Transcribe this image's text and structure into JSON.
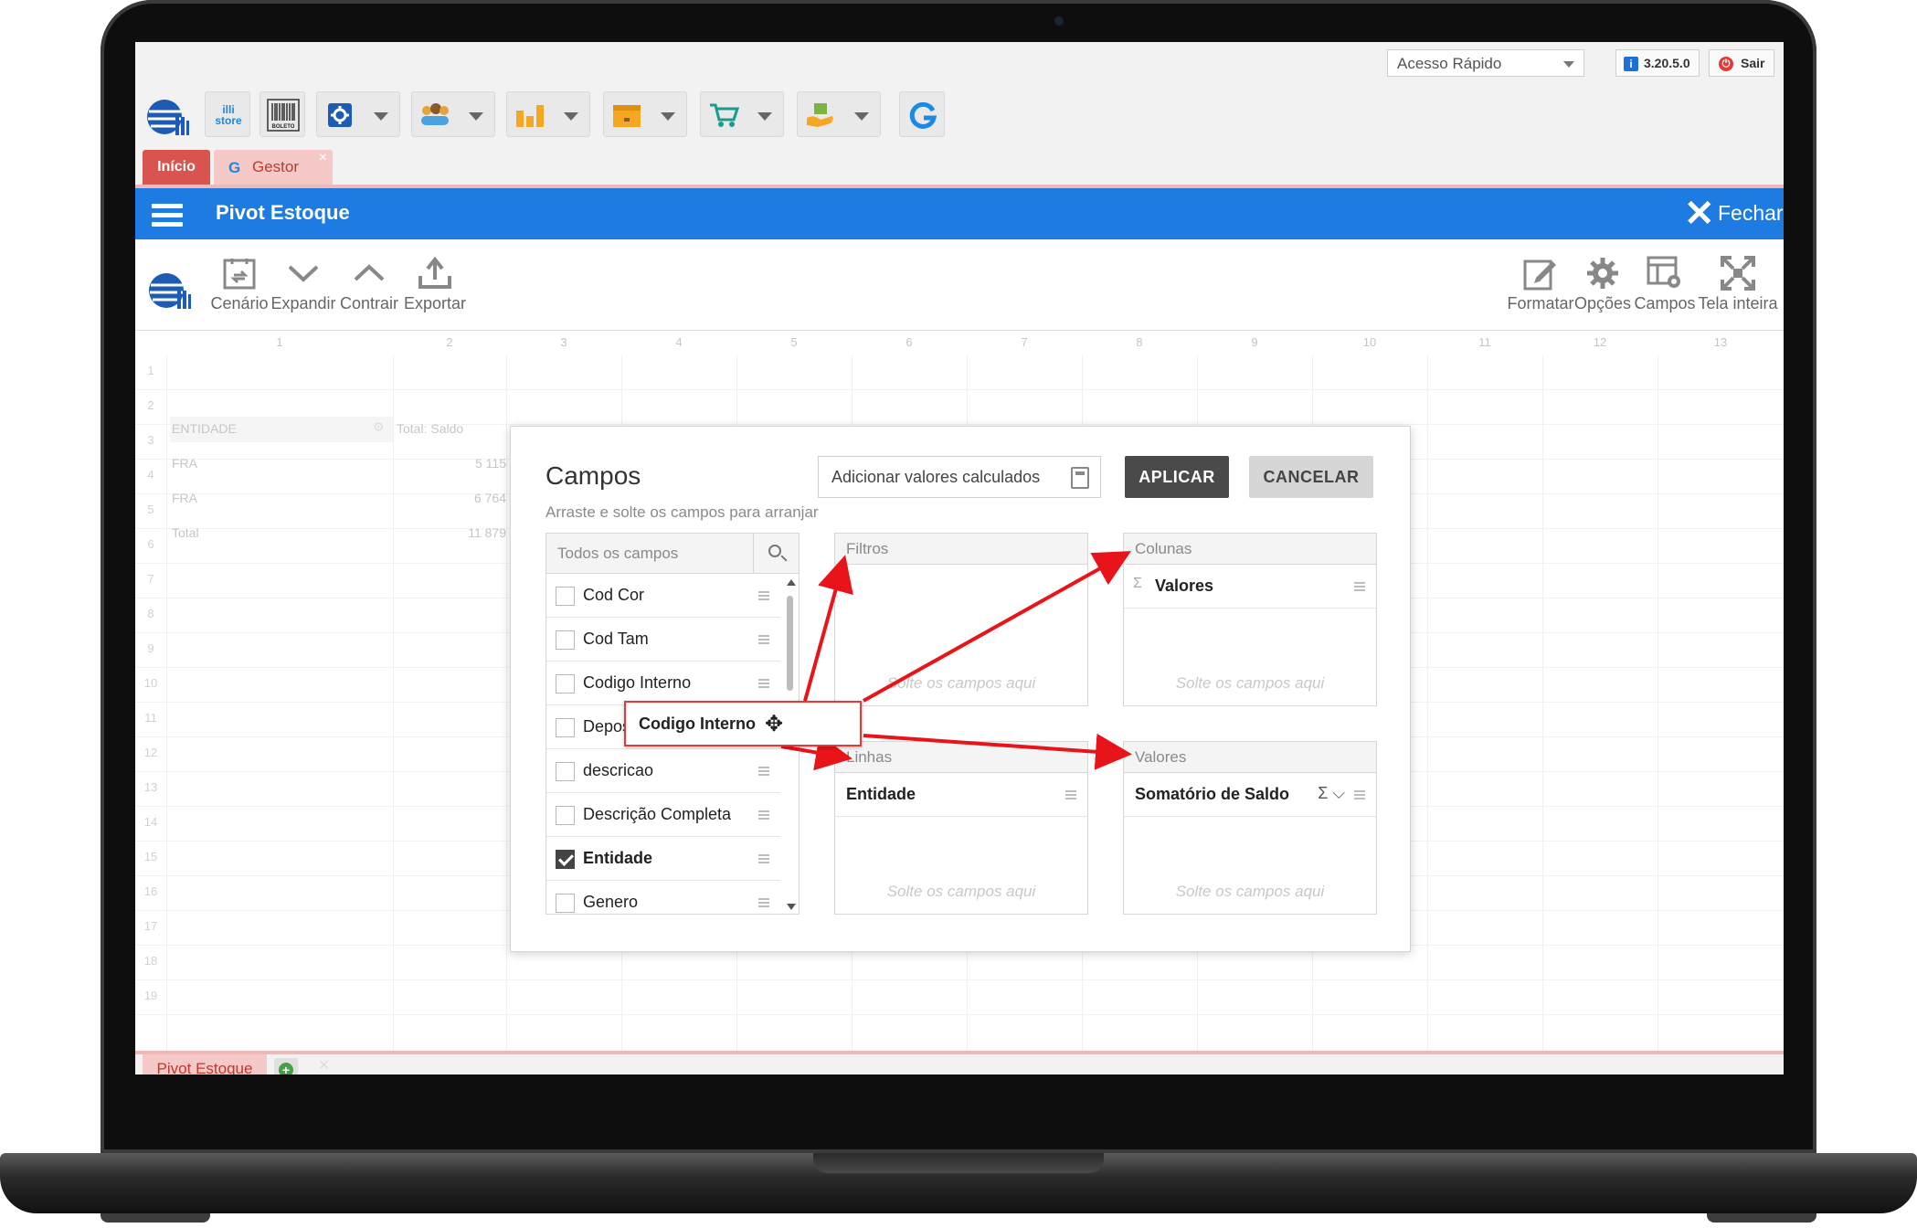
{
  "topbar": {
    "quick_access": "Acesso Rápido",
    "version": "3.20.5.0",
    "logout": "Sair",
    "tools": [
      {
        "name": "store-icon",
        "label": "illi store"
      },
      {
        "name": "barcode-icon",
        "label": "BOLETO"
      },
      {
        "name": "gear-icon",
        "label": ""
      },
      {
        "name": "users-icon",
        "label": ""
      },
      {
        "name": "bar-chart-icon",
        "label": ""
      },
      {
        "name": "box-icon",
        "label": ""
      },
      {
        "name": "cart-icon",
        "label": ""
      },
      {
        "name": "package-hand-icon",
        "label": ""
      },
      {
        "name": "refresh-icon",
        "label": ""
      }
    ]
  },
  "tabs": {
    "inicio": "Início",
    "gestor": "Gestor",
    "bottom": "Pivot Estoque"
  },
  "titlebar": {
    "title": "Pivot Estoque",
    "close": "Fechar"
  },
  "toolbar": {
    "left": [
      "Cenário",
      "Expandir",
      "Contrair",
      "Exportar"
    ],
    "right": [
      "Formatar",
      "Opções",
      "Campos",
      "Tela inteira"
    ]
  },
  "grid": {
    "column_headers": [
      "1",
      "2",
      "3",
      "4",
      "5",
      "6",
      "7",
      "8",
      "9",
      "10",
      "11",
      "12",
      "13"
    ],
    "row_numbers": [
      "1",
      "2",
      "3",
      "4",
      "5",
      "6",
      "7",
      "8",
      "9",
      "10",
      "11",
      "12",
      "13",
      "14",
      "15",
      "16",
      "17",
      "18",
      "19"
    ],
    "header": {
      "entity": "ENTIDADE",
      "total": "Total: Saldo"
    },
    "rows": [
      {
        "label": "FRA",
        "value": "5 115"
      },
      {
        "label": "FRA",
        "value": "6 764"
      },
      {
        "label": "Total",
        "value": "11 879"
      }
    ]
  },
  "dialog": {
    "title": "Campos",
    "subtitle": "Arraste e solte os campos para arranjar",
    "calc_button": "Adicionar valores calculados",
    "apply": "APLICAR",
    "cancel": "CANCELAR",
    "all_fields_label": "Todos os campos",
    "fields": [
      {
        "label": "Cod Cor",
        "checked": false
      },
      {
        "label": "Cod Tam",
        "checked": false
      },
      {
        "label": "Codigo Interno",
        "checked": false
      },
      {
        "label": "Depos",
        "checked": false
      },
      {
        "label": "descricao",
        "checked": false
      },
      {
        "label": "Descrição Completa",
        "checked": false
      },
      {
        "label": "Entidade",
        "checked": true
      },
      {
        "label": "Genero",
        "checked": false
      }
    ],
    "drag_ghost": "Codigo Interno",
    "zones": {
      "filtros": {
        "title": "Filtros",
        "placeholder": "Solte os campos aqui"
      },
      "colunas": {
        "title": "Colunas",
        "item": "Valores",
        "placeholder": "Solte os campos aqui"
      },
      "linhas": {
        "title": "Linhas",
        "item": "Entidade",
        "placeholder": "Solte os campos aqui"
      },
      "valores": {
        "title": "Valores",
        "item": "Somatório de Saldo",
        "placeholder": "Solte os campos aqui"
      }
    },
    "sigma": "Σ"
  },
  "colors": {
    "titlebar": "#1e7be1",
    "tab_active": "#d9534f",
    "tab_inactive": "#f4c9c7",
    "apply": "#4a4a4a",
    "arrow": "#e8141a"
  }
}
